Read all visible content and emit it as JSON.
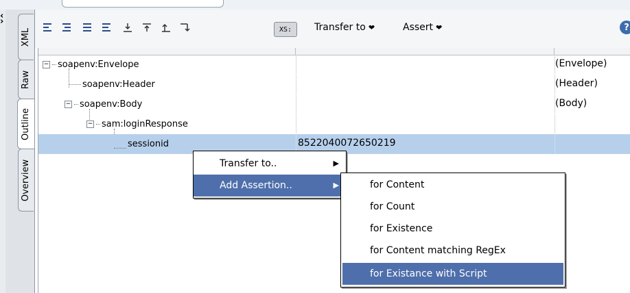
{
  "side_tabs": [
    "XML",
    "Raw",
    "Outline",
    "Overview"
  ],
  "toolbar": {
    "xs_label": "XS:",
    "transfer_label": "Transfer to",
    "assert_label": "Assert",
    "help_label": "?"
  },
  "outline": {
    "rows": [
      {
        "name": "soapenv:Envelope",
        "value": "",
        "type": "(Envelope)"
      },
      {
        "name": "soapenv:Header",
        "value": "",
        "type": "(Header)"
      },
      {
        "name": "soapenv:Body",
        "value": "",
        "type": "(Body)"
      },
      {
        "name": "sam:loginResponse",
        "value": "",
        "type": ""
      },
      {
        "name": "sessionid",
        "value": "8522040072650219",
        "type": ""
      }
    ]
  },
  "context_menu": {
    "items": [
      {
        "label": "Transfer to.."
      },
      {
        "label": "Add Assertion.."
      }
    ]
  },
  "assertion_submenu": {
    "items": [
      {
        "label": "for Content"
      },
      {
        "label": "for Count"
      },
      {
        "label": "for Existence"
      },
      {
        "label": "for Content matching RegEx"
      },
      {
        "label": "for Existance with Script"
      }
    ]
  }
}
